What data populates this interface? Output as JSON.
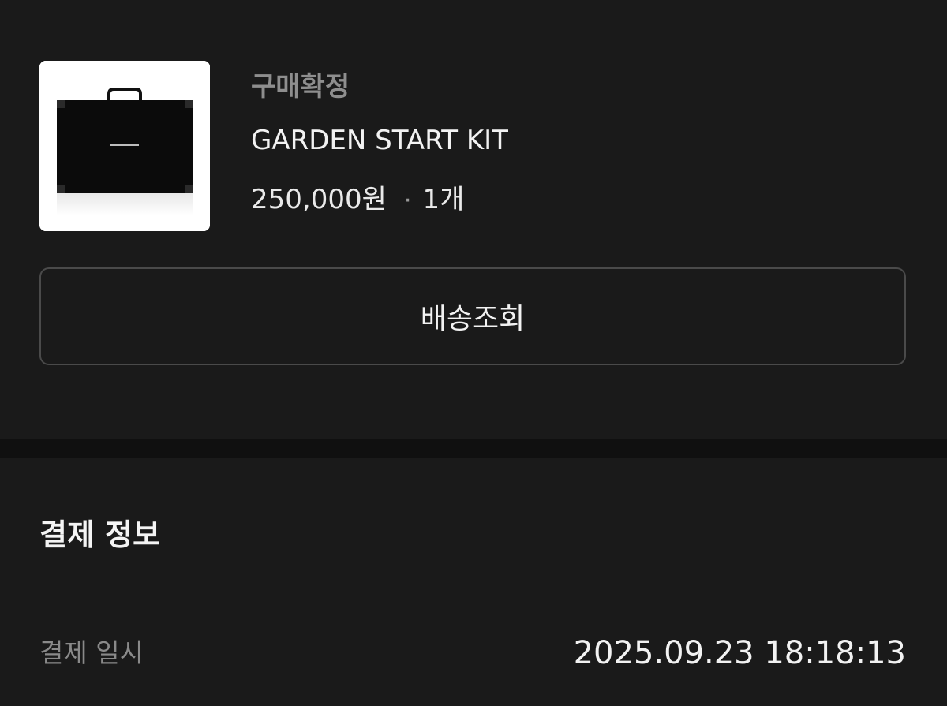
{
  "order": {
    "status": "구매확정",
    "product_name": "GARDEN START KIT",
    "price": "250,000원",
    "separator": "·",
    "quantity": "1개",
    "thumbnail_icon": "black-gift-box-image",
    "tracking_button_label": "배송조회"
  },
  "payment": {
    "title": "결제 정보",
    "datetime_label": "결제 일시",
    "datetime_value": "2025.09.23 18:18:13"
  }
}
